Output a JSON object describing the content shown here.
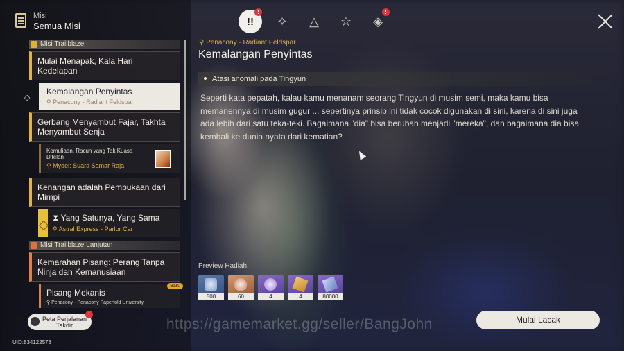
{
  "header": {
    "subtitle": "Misi",
    "title": "Semua Misi"
  },
  "tabs": [
    {
      "icon": "exclamation-icon",
      "label": "!!",
      "active": true,
      "badge": "!"
    },
    {
      "icon": "star-compass-icon",
      "label": "✧"
    },
    {
      "icon": "triangle-icon",
      "label": "△"
    },
    {
      "icon": "star-icon",
      "label": "☆"
    },
    {
      "icon": "diamond-icon",
      "label": "◈",
      "badge": "!"
    }
  ],
  "list": {
    "cat1": "Misi Trailblaze",
    "q1": "Mulai Menapak, Kala Hari Kedelapan",
    "q1_sub": {
      "title": "Kemalangan Penyintas",
      "loc": "Penacony - Radiant Feldspar"
    },
    "q2": "Gerbang Menyambut Fajar, Takhta Menyambut Senja",
    "q2_sub": {
      "title": "Kemuliaan, Racun yang Tak Kuasa Ditelan",
      "loc": "Mydei: Suara Samar Raja"
    },
    "q3": "Kenangan adalah Pembukaan dari Mimpi",
    "q3_sub": {
      "title": "Yang Satunya, Yang Sama",
      "loc": "Astral Express - Parlor Car"
    },
    "cat2": "Misi Trailblaze Lanjutan",
    "q4": "Kemarahan Pisang: Perang Tanpa Ninja dan Kemanusiaan",
    "q4_sub": {
      "title": "Pisang Mekanis",
      "loc": "Penacony - Penacony Paperfold University",
      "badge": "Baru"
    }
  },
  "peta": {
    "label": "Peta Perjalanan Takdir",
    "badge": "!"
  },
  "uid": "UID:834122578",
  "detail": {
    "location": "Penacony - Radiant Feldspar",
    "title": "Kemalangan Penyintas",
    "objective": "Atasi anomali pada Tingyun",
    "description": "Seperti kata pepatah, kalau kamu menanam seorang Tingyun di musim semi, maka kamu bisa memanennya di musim gugur ... sepertinya prinsip ini tidak cocok digunakan di sini, karena di sini juga ada lebih dari satu teka-teki. Bagaimana \"dia\" bisa berubah menjadi \"mereka\", dan bagaimana dia bisa kembali ke dunia nyata dari kematian?"
  },
  "rewards": {
    "title": "Preview Hadiah",
    "items": [
      {
        "icon": "credit-icon",
        "qty": "500",
        "color": "blue"
      },
      {
        "icon": "material-icon",
        "qty": "60",
        "color": "orange"
      },
      {
        "icon": "star-rail-pass-icon",
        "qty": "4",
        "color": "purple"
      },
      {
        "icon": "ration-icon",
        "qty": "4",
        "color": "purple"
      },
      {
        "icon": "exp-book-icon",
        "qty": "80000",
        "color": "purple"
      }
    ]
  },
  "track_button": "Mulai Lacak",
  "watermark": "https://gamemarket.gg/seller/BangJohn"
}
